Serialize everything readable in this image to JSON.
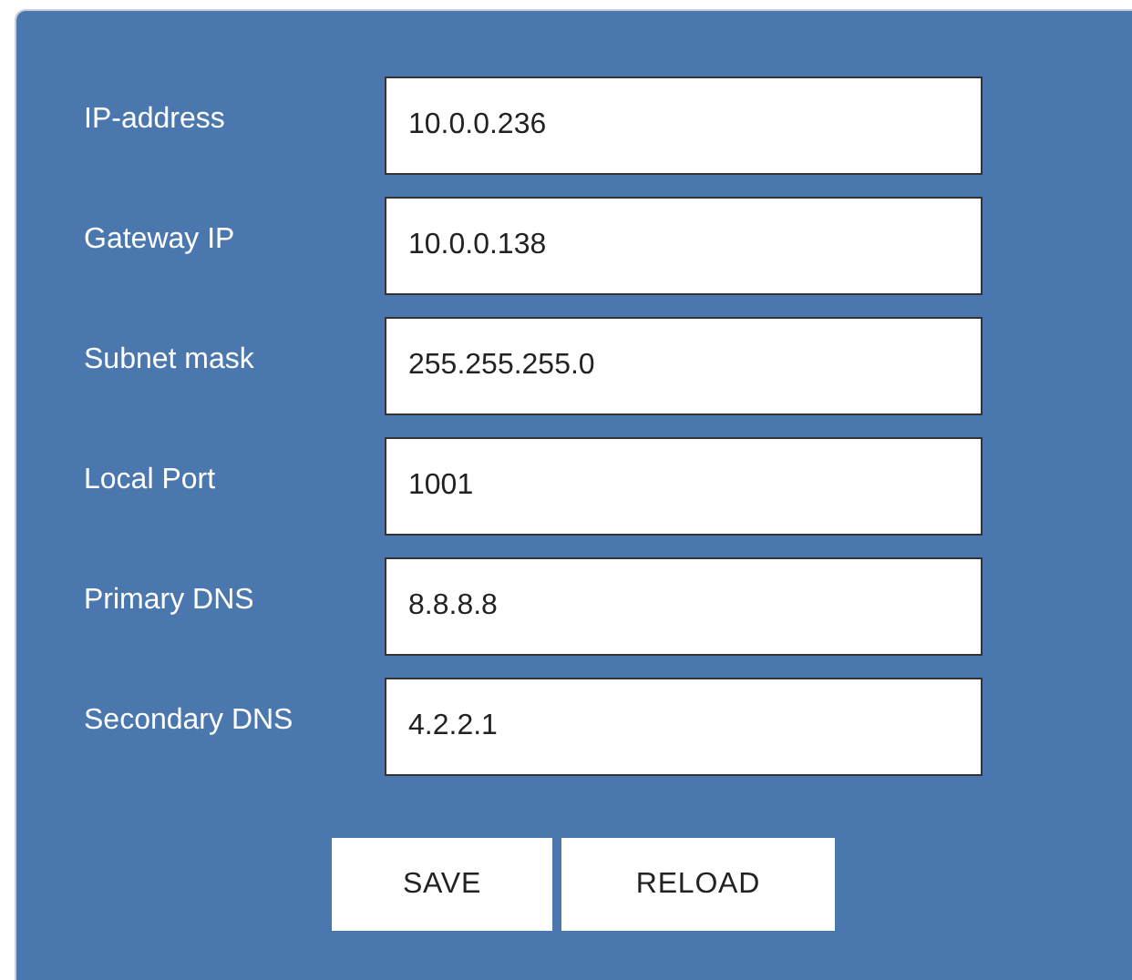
{
  "fields": [
    {
      "label": "IP-address",
      "value": "10.0.0.236"
    },
    {
      "label": "Gateway IP",
      "value": "10.0.0.138"
    },
    {
      "label": "Subnet mask",
      "value": "255.255.255.0"
    },
    {
      "label": "Local Port",
      "value": "1001"
    },
    {
      "label": "Primary DNS",
      "value": "8.8.8.8"
    },
    {
      "label": "Secondary DNS",
      "value": "4.2.2.1"
    }
  ],
  "buttons": [
    "SAVE",
    "RELOAD"
  ]
}
